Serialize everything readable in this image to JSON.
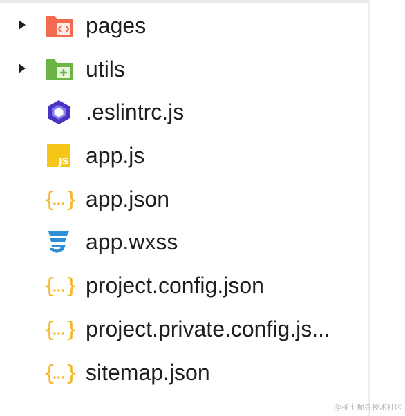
{
  "explorer": {
    "items": [
      {
        "label": "pages",
        "kind": "folder",
        "icon": "pages-folder-icon",
        "expandable": true,
        "color": "#f26b4f"
      },
      {
        "label": "utils",
        "kind": "folder",
        "icon": "utils-folder-icon",
        "expandable": true,
        "color": "#6bb445"
      },
      {
        "label": ".eslintrc.js",
        "kind": "file",
        "icon": "eslint-icon",
        "expandable": false,
        "color": "#4b32c3"
      },
      {
        "label": "app.js",
        "kind": "file",
        "icon": "javascript-icon",
        "expandable": false,
        "color": "#f5c518"
      },
      {
        "label": "app.json",
        "kind": "file",
        "icon": "json-icon",
        "expandable": false,
        "color": "#f5b62a"
      },
      {
        "label": "app.wxss",
        "kind": "file",
        "icon": "css-icon",
        "expandable": false,
        "color": "#2d8fd5"
      },
      {
        "label": "project.config.json",
        "kind": "file",
        "icon": "json-icon",
        "expandable": false,
        "color": "#f5b62a"
      },
      {
        "label": "project.private.config.js...",
        "kind": "file",
        "icon": "json-icon",
        "expandable": false,
        "color": "#f5b62a"
      },
      {
        "label": "sitemap.json",
        "kind": "file",
        "icon": "json-icon",
        "expandable": false,
        "color": "#f5b62a"
      }
    ]
  },
  "watermark": "@稀土掘金技术社区"
}
